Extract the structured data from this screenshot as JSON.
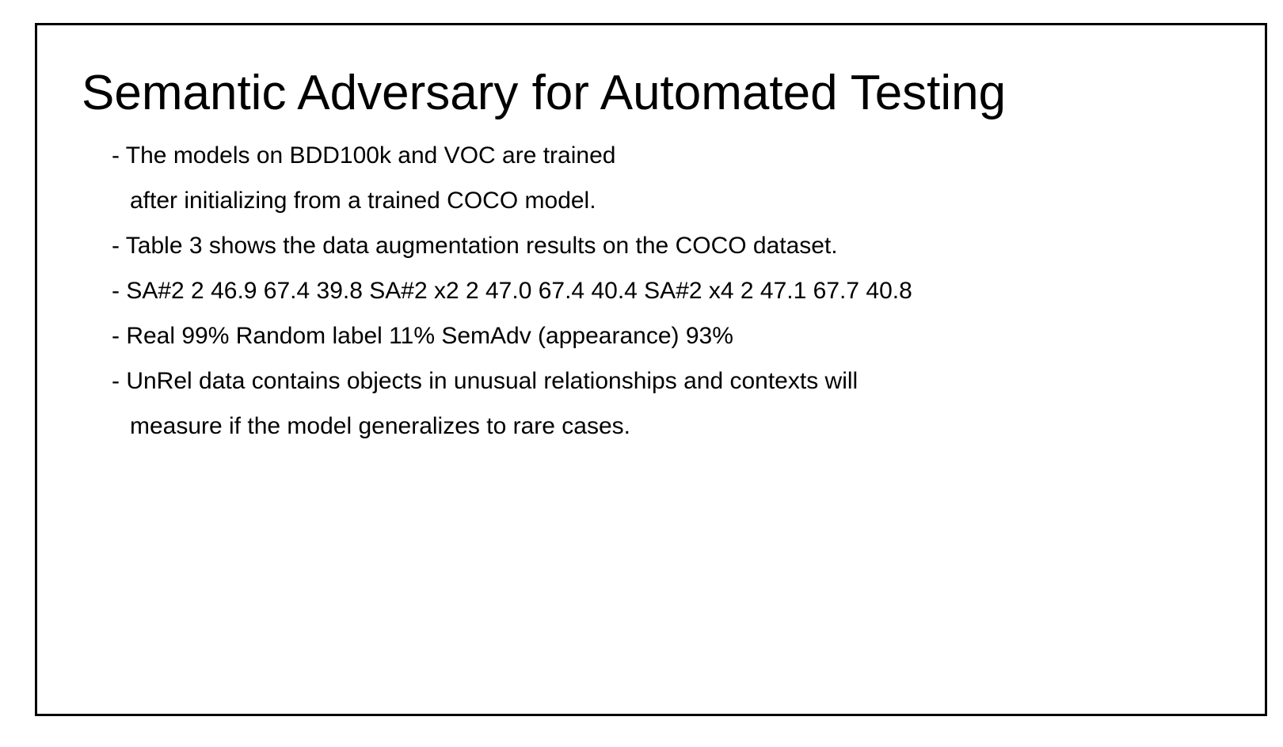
{
  "slide": {
    "title": "Semantic Adversary for Automated Testing",
    "bullets": [
      {
        "lines": [
          "- The models on BDD100k and VOC are trained",
          "after initializing from a trained COCO model."
        ]
      },
      {
        "lines": [
          "- Table 3 shows the data augmentation results on the COCO dataset."
        ]
      },
      {
        "lines": [
          "- SA#2 2 46.9 67.4 39.8 SA#2 x2 2 47.0 67.4 40.4 SA#2 x4 2 47.1 67.7 40.8"
        ]
      },
      {
        "lines": [
          "- Real 99% Random label 11% SemAdv (appearance) 93%"
        ]
      },
      {
        "lines": [
          "- UnRel data contains objects in unusual relationships and contexts will",
          "measure if the model generalizes to rare cases."
        ]
      }
    ]
  }
}
